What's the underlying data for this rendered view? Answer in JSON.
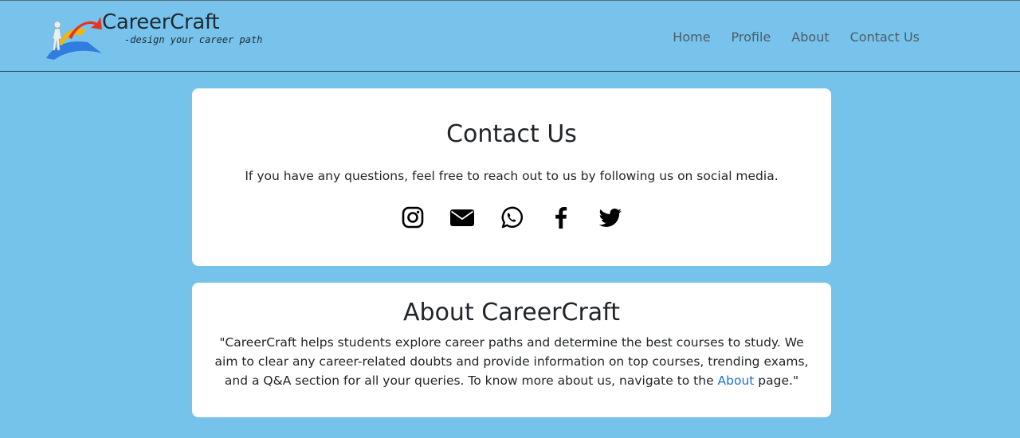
{
  "brand": {
    "name": "CareerCraft",
    "tagline": "-design your career path",
    "logo_icon": "career-path-logo-icon"
  },
  "nav": {
    "items": [
      {
        "label": "Home"
      },
      {
        "label": "Profile"
      },
      {
        "label": "About"
      },
      {
        "label": "Contact Us"
      }
    ]
  },
  "contact": {
    "title": "Contact Us",
    "text": "If you have any questions, feel free to reach out to us by following us on social media.",
    "social": [
      {
        "icon": "instagram-icon"
      },
      {
        "icon": "envelope-icon"
      },
      {
        "icon": "whatsapp-icon"
      },
      {
        "icon": "facebook-icon"
      },
      {
        "icon": "twitter-icon"
      }
    ]
  },
  "about": {
    "title": "About CareerCraft",
    "text_before": "\"CareerCraft helps students explore career paths and determine the best courses to study. We aim to clear any career-related doubts and provide information on top courses, trending exams, and a Q&A section for all your queries. To know more about us, navigate to the ",
    "link_label": "About",
    "text_after": " page.\""
  },
  "colors": {
    "background": "#75c3ea",
    "card": "#ffffff",
    "link": "#1a73c9",
    "nav_text": "#4f5b66"
  }
}
